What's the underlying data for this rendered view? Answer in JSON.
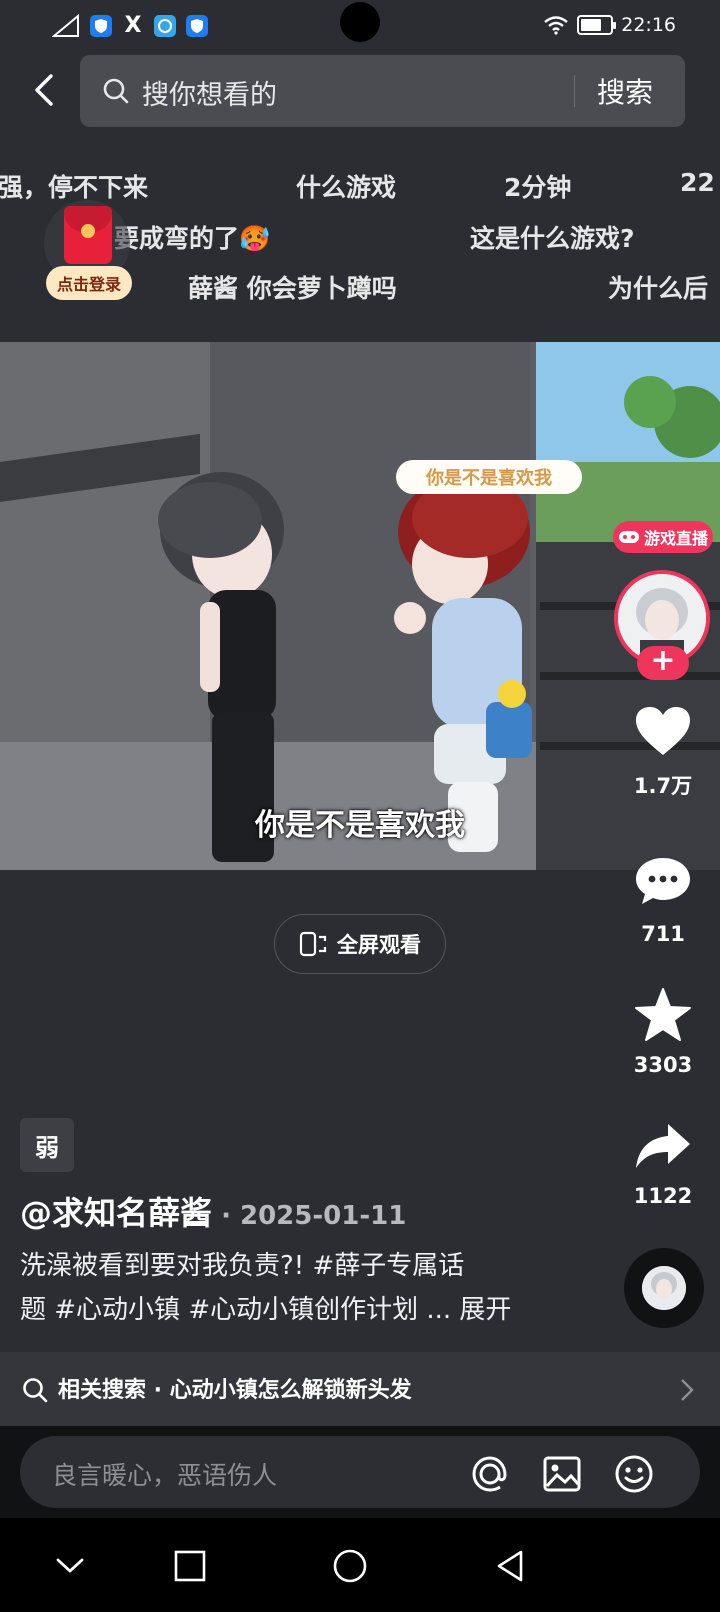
{
  "status_bar": {
    "time": "22:16",
    "apps": [
      "shield-app",
      "x-app",
      "chat-app",
      "shield-app"
    ],
    "battery_level": 0.7,
    "icons": [
      "signal-icon",
      "wifi-icon",
      "battery-icon"
    ]
  },
  "header": {
    "search_placeholder": "搜你想看的",
    "search_button": "搜索"
  },
  "suggestions": {
    "row1": [
      "强，停不下来",
      "什么游戏",
      "2分钟",
      "22"
    ],
    "row2": [
      "要成弯的了🥵",
      "这是什么游戏?"
    ],
    "row3": [
      "薛酱 你会萝卜蹲吗",
      "为什么后"
    ]
  },
  "login_badge": {
    "label": "点击登录"
  },
  "video": {
    "bubble_text": "你是不是喜欢我",
    "subtitle": "你是不是喜欢我",
    "fullscreen_label": "全屏观看"
  },
  "right_rail": {
    "live_label": "游戏直播",
    "follow_symbol": "+",
    "like_count": "1.7万",
    "comment_count": "711",
    "favorite_count": "3303",
    "share_count": "1122"
  },
  "post": {
    "ad_tag": "弱",
    "author": "@求知名薛酱",
    "date_sep": " · ",
    "date": "2025-01-11",
    "desc_line1": "洗澡被看到要对我负责?!  #薛子专属话",
    "desc_line2": "题 #心动小镇 #心动小镇创作计划 ... 展开"
  },
  "related": {
    "label": "相关搜索 · 心动小镇怎么解锁新头发"
  },
  "comment": {
    "placeholder": "良言暖心，恶语伤人"
  },
  "colors": {
    "background": "#2b2d32",
    "accent": "#f0355d",
    "search_bg": "#4a4c52"
  }
}
